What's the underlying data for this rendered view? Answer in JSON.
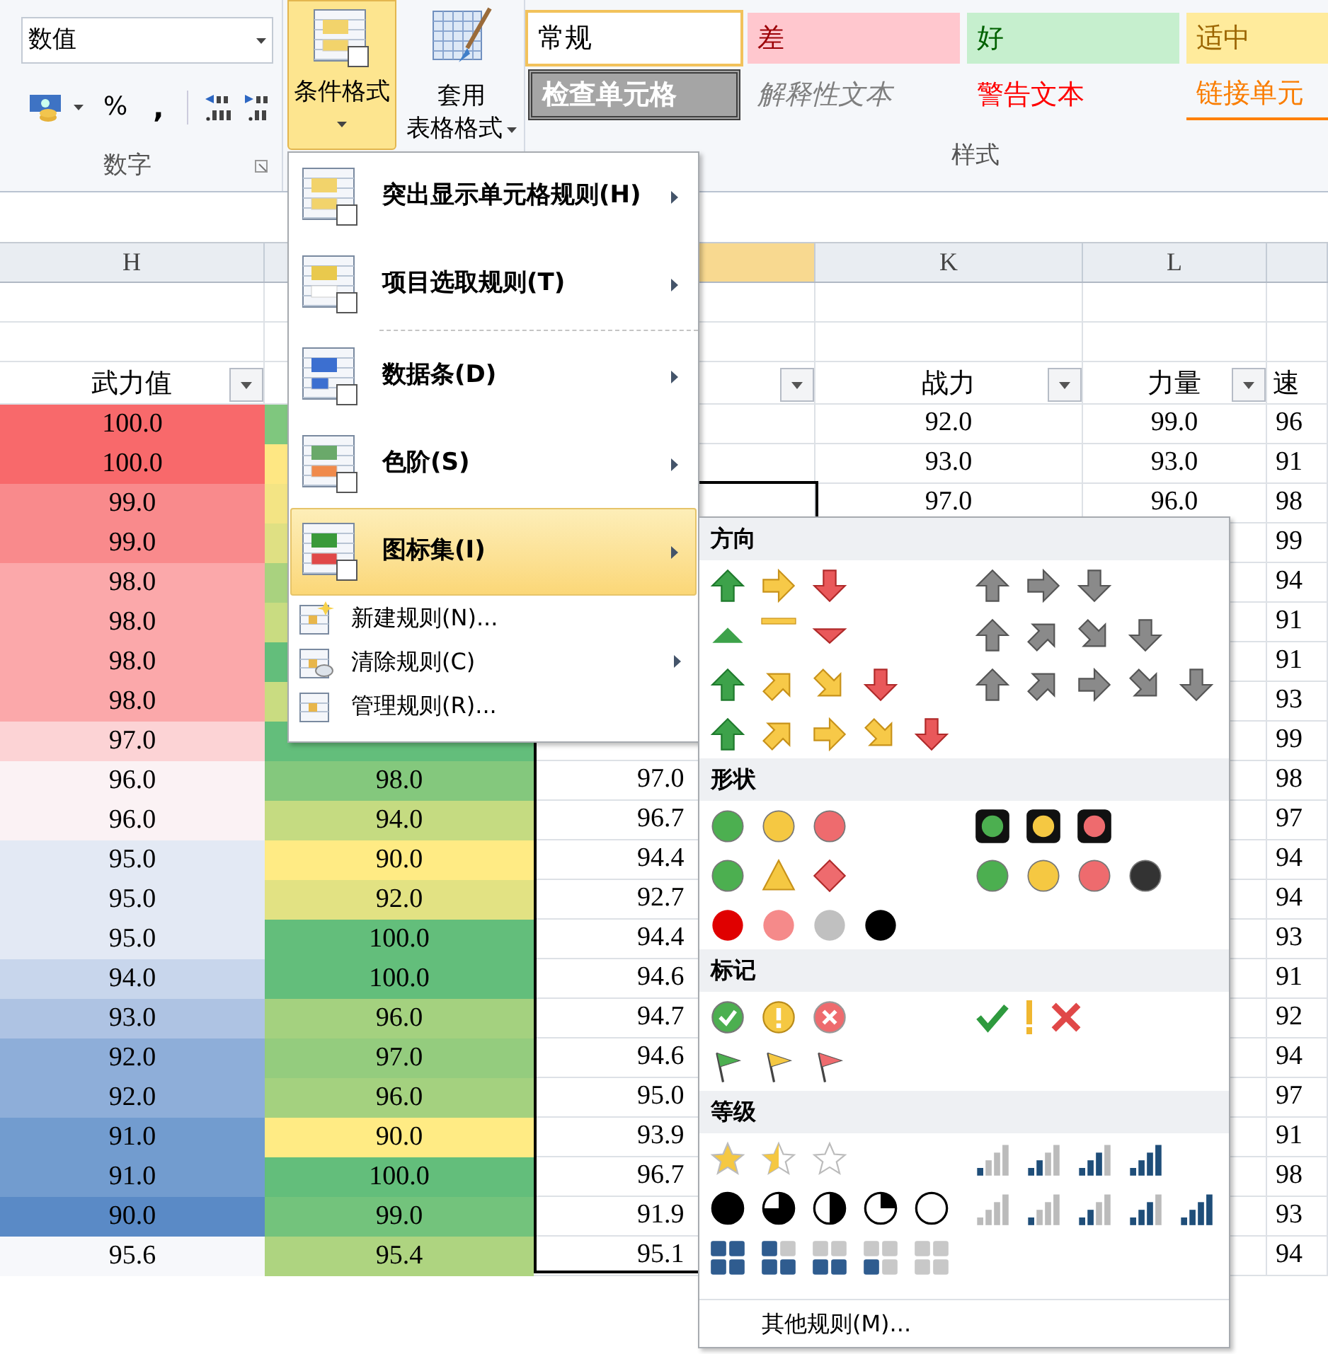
{
  "ribbon": {
    "number_group": {
      "format": "数值",
      "percent": "%",
      "comma": ",",
      "label": "数字"
    },
    "conditional_format": {
      "label": "条件格式",
      "selected": true
    },
    "table_format": {
      "lines": [
        "套用",
        "表格格式"
      ]
    },
    "styles": [
      {
        "label": "常规",
        "kind": "normal",
        "selected": true
      },
      {
        "label": "差",
        "kind": "bad",
        "selected": false
      },
      {
        "label": "好",
        "kind": "good",
        "selected": false
      },
      {
        "label": "适中",
        "kind": "neutral",
        "selected": false
      },
      {
        "label": "检查单元格",
        "kind": "check",
        "selected": false
      },
      {
        "label": "解释性文本",
        "kind": "explanatory",
        "selected": false
      },
      {
        "label": "警告文本",
        "kind": "warning",
        "selected": false
      },
      {
        "label": "链接单元",
        "kind": "linked",
        "selected": false
      }
    ],
    "styles_label": "样式"
  },
  "sheet": {
    "columns": [
      {
        "letter": "H",
        "selected": false,
        "header": "武力值"
      },
      {},
      {
        "selected": true
      },
      {
        "letter": "K",
        "selected": false,
        "header": "战力"
      },
      {
        "letter": "L",
        "selected": false,
        "header": "力量"
      },
      {
        "selected": false,
        "header": "速"
      }
    ],
    "rows": [
      {
        "h": {
          "value": "100.0",
          "color": "#f8696b"
        },
        "i": {
          "color": "#7fc77e"
        },
        "k": "92.0",
        "l": "99.0",
        "m": "96"
      },
      {
        "h": {
          "value": "100.0",
          "color": "#f8696b"
        },
        "i": {
          "color": "#fee783"
        },
        "k": "93.0",
        "l": "93.0",
        "m": "91"
      },
      {
        "h": {
          "value": "99.0",
          "color": "#f98a8c"
        },
        "i": {
          "color": "#f3e484"
        },
        "k": "97.0",
        "l": "96.0",
        "m": "98"
      },
      {
        "h": {
          "value": "99.0",
          "color": "#f98a8c"
        },
        "i": {
          "color": "#dfe083"
        },
        "m": "99"
      },
      {
        "h": {
          "value": "98.0",
          "color": "#fba8aa"
        },
        "i": {
          "color": "#a9d27f"
        },
        "m": "94"
      },
      {
        "h": {
          "value": "98.0",
          "color": "#fba8aa"
        },
        "i": {
          "color": "#c9dc81"
        },
        "m": "91"
      },
      {
        "h": {
          "value": "98.0",
          "color": "#fba8aa"
        },
        "i": {
          "color": "#63be7b"
        },
        "m": "91"
      },
      {
        "h": {
          "value": "98.0",
          "color": "#fba8aa"
        },
        "i": {
          "color": "#c9dc81"
        },
        "m": "93"
      },
      {
        "h": {
          "value": "97.0",
          "color": "#fcd3d5"
        },
        "i": {
          "color": "#63be7b"
        },
        "m": "99"
      },
      {
        "h": {
          "value": "96.0",
          "color": "#fbf2f4"
        },
        "i": {
          "value": "98.0",
          "color": "#84c87d"
        },
        "j": "97.0",
        "m": "98"
      },
      {
        "h": {
          "value": "96.0",
          "color": "#fbf2f4"
        },
        "i": {
          "value": "94.0",
          "color": "#c5db81"
        },
        "j": "96.7",
        "m": "97"
      },
      {
        "h": {
          "value": "95.0",
          "color": "#e3e9f4"
        },
        "i": {
          "value": "90.0",
          "color": "#ffeb84"
        },
        "j": "94.4",
        "m": "94"
      },
      {
        "h": {
          "value": "95.0",
          "color": "#e3e9f4"
        },
        "i": {
          "value": "92.0",
          "color": "#e2e283"
        },
        "j": "92.7",
        "m": "94"
      },
      {
        "h": {
          "value": "95.0",
          "color": "#e3e9f4"
        },
        "i": {
          "value": "100.0",
          "color": "#63be7b"
        },
        "j": "94.4",
        "m": "93"
      },
      {
        "h": {
          "value": "94.0",
          "color": "#c8d6ec"
        },
        "i": {
          "value": "100.0",
          "color": "#63be7b"
        },
        "j": "94.6",
        "m": "91"
      },
      {
        "h": {
          "value": "93.0",
          "color": "#aec3e3"
        },
        "i": {
          "value": "96.0",
          "color": "#a4d17f"
        },
        "j": "94.7",
        "m": "92"
      },
      {
        "h": {
          "value": "92.0",
          "color": "#8eaed9"
        },
        "i": {
          "value": "97.0",
          "color": "#94cc7e"
        },
        "j": "94.6",
        "m": "94"
      },
      {
        "h": {
          "value": "92.0",
          "color": "#8eaed9"
        },
        "i": {
          "value": "96.0",
          "color": "#a4d17f"
        },
        "j": "95.0",
        "m": "97"
      },
      {
        "h": {
          "value": "91.0",
          "color": "#729ccf"
        },
        "i": {
          "value": "90.0",
          "color": "#ffeb84"
        },
        "j": "93.9",
        "m": "91"
      },
      {
        "h": {
          "value": "91.0",
          "color": "#729ccf"
        },
        "i": {
          "value": "100.0",
          "color": "#63be7b"
        },
        "j": "96.7",
        "m": "98"
      },
      {
        "h": {
          "value": "90.0",
          "color": "#5a8ac6"
        },
        "i": {
          "value": "99.0",
          "color": "#73c37c"
        },
        "j": "91.9",
        "m": "93"
      },
      {
        "h": {
          "value": "95.6",
          "color": "#f7f8fb"
        },
        "i": {
          "value": "95.4",
          "color": "#aed480"
        },
        "j": "95.1",
        "m": "94"
      }
    ]
  },
  "menu": {
    "items": [
      {
        "label": "突出显示单元格规则(H)",
        "kind": "large",
        "selected": false,
        "submenu": true
      },
      {
        "label": "项目选取规则(T)",
        "kind": "large",
        "selected": false,
        "submenu": true
      },
      {
        "label": "数据条(D)",
        "kind": "large",
        "selected": false,
        "submenu": true
      },
      {
        "label": "色阶(S)",
        "kind": "large",
        "selected": false,
        "submenu": true
      },
      {
        "label": "图标集(I)",
        "kind": "large",
        "selected": true,
        "submenu": true
      },
      {
        "label": "新建规则(N)...",
        "kind": "small",
        "selected": false,
        "submenu": false
      },
      {
        "label": "清除规则(C)",
        "kind": "small",
        "selected": false,
        "submenu": true
      },
      {
        "label": "管理规则(R)...",
        "kind": "small",
        "selected": false,
        "submenu": false
      }
    ]
  },
  "icon_sets": {
    "sections": [
      {
        "title": "方向"
      },
      {
        "title": "形状"
      },
      {
        "title": "标记"
      },
      {
        "title": "等级"
      }
    ],
    "more": "其他规则(M)..."
  }
}
